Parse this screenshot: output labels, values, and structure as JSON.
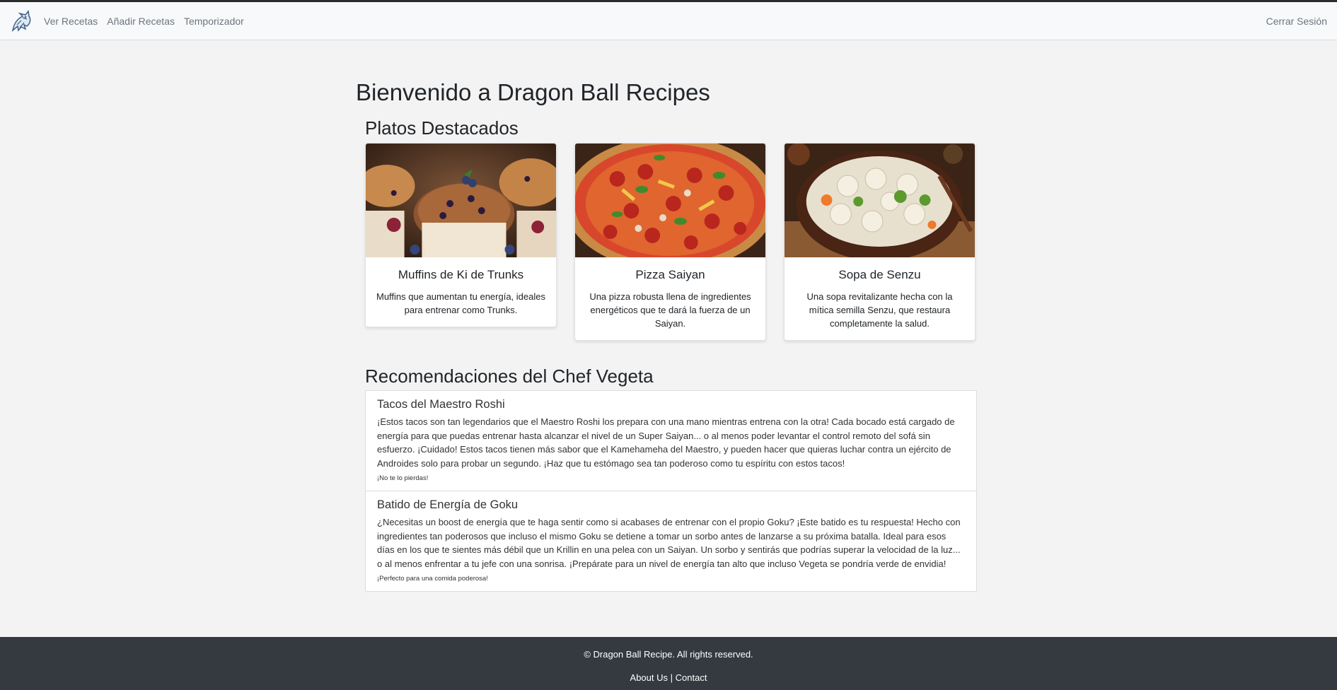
{
  "nav": {
    "logo_icon": "dragon-logo-icon",
    "items": [
      {
        "label": "Ver Recetas"
      },
      {
        "label": "Añadir Recetas"
      },
      {
        "label": "Temporizador"
      }
    ],
    "logout_label": "Cerrar Sesión"
  },
  "page": {
    "title": "Bienvenido a Dragon Ball Recipes"
  },
  "featured": {
    "title": "Platos Destacados",
    "cards": [
      {
        "title": "Muffins de Ki de Trunks",
        "text": "Muffins que aumentan tu energía, ideales para entrenar como Trunks.",
        "image": "muffins-photo"
      },
      {
        "title": "Pizza Saiyan",
        "text": "Una pizza robusta llena de ingredientes energéticos que te dará la fuerza de un Saiyan.",
        "image": "pizza-photo"
      },
      {
        "title": "Sopa de Senzu",
        "text": "Una sopa revitalizante hecha con la mítica semilla Senzu, que restaura completamente la salud.",
        "image": "soup-photo"
      }
    ]
  },
  "recommendations": {
    "title": "Recomendaciones del Chef Vegeta",
    "items": [
      {
        "name": "Tacos del Maestro Roshi",
        "desc": "¡Estos tacos son tan legendarios que el Maestro Roshi los prepara con una mano mientras entrena con la otra! Cada bocado está cargado de energía para que puedas entrenar hasta alcanzar el nivel de un Super Saiyan... o al menos poder levantar el control remoto del sofá sin esfuerzo. ¡Cuidado! Estos tacos tienen más sabor que el Kamehameha del Maestro, y pueden hacer que quieras luchar contra un ejército de Androides solo para probar un segundo. ¡Haz que tu estómago sea tan poderoso como tu espíritu con estos tacos!",
        "note": "¡No te lo pierdas!"
      },
      {
        "name": "Batido de Energía de Goku",
        "desc": "¿Necesitas un boost de energía que te haga sentir como si acabases de entrenar con el propio Goku? ¡Este batido es tu respuesta! Hecho con ingredientes tan poderosos que incluso el mismo Goku se detiene a tomar un sorbo antes de lanzarse a su próxima batalla. Ideal para esos días en los que te sientes más débil que un Krillin en una pelea con un Saiyan. Un sorbo y sentirás que podrías superar la velocidad de la luz... o al menos enfrentar a tu jefe con una sonrisa. ¡Prepárate para un nivel de energía tan alto que incluso Vegeta se pondría verde de envidia!",
        "note": "¡Perfecto para una comida poderosa!"
      }
    ]
  },
  "footer": {
    "copyright": "© Dragon Ball Recipe. All rights reserved.",
    "about": "About Us",
    "separator": "|",
    "contact": "Contact"
  }
}
